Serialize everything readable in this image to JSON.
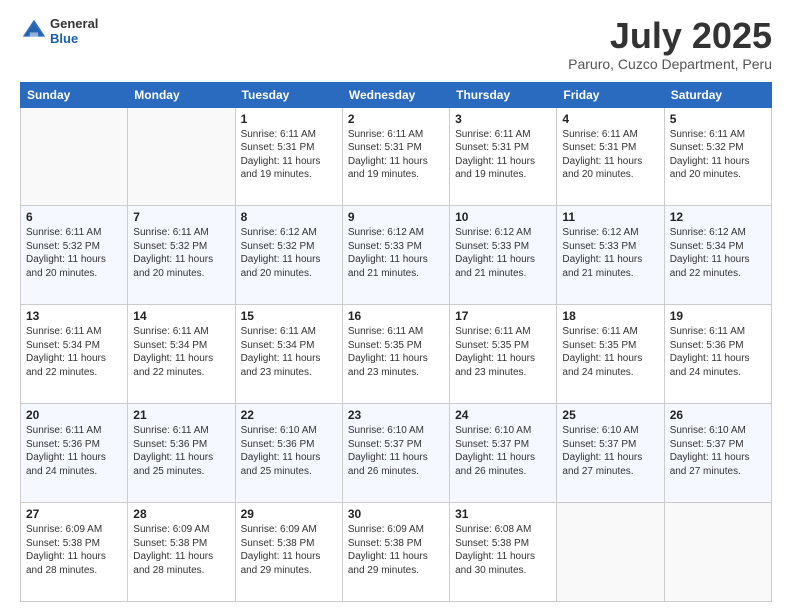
{
  "header": {
    "logo_general": "General",
    "logo_blue": "Blue",
    "title": "July 2025",
    "subtitle": "Paruro, Cuzco Department, Peru"
  },
  "calendar": {
    "days_of_week": [
      "Sunday",
      "Monday",
      "Tuesday",
      "Wednesday",
      "Thursday",
      "Friday",
      "Saturday"
    ],
    "weeks": [
      [
        {
          "day": "",
          "info": ""
        },
        {
          "day": "",
          "info": ""
        },
        {
          "day": "1",
          "info": "Sunrise: 6:11 AM\nSunset: 5:31 PM\nDaylight: 11 hours and 19 minutes."
        },
        {
          "day": "2",
          "info": "Sunrise: 6:11 AM\nSunset: 5:31 PM\nDaylight: 11 hours and 19 minutes."
        },
        {
          "day": "3",
          "info": "Sunrise: 6:11 AM\nSunset: 5:31 PM\nDaylight: 11 hours and 19 minutes."
        },
        {
          "day": "4",
          "info": "Sunrise: 6:11 AM\nSunset: 5:31 PM\nDaylight: 11 hours and 20 minutes."
        },
        {
          "day": "5",
          "info": "Sunrise: 6:11 AM\nSunset: 5:32 PM\nDaylight: 11 hours and 20 minutes."
        }
      ],
      [
        {
          "day": "6",
          "info": "Sunrise: 6:11 AM\nSunset: 5:32 PM\nDaylight: 11 hours and 20 minutes."
        },
        {
          "day": "7",
          "info": "Sunrise: 6:11 AM\nSunset: 5:32 PM\nDaylight: 11 hours and 20 minutes."
        },
        {
          "day": "8",
          "info": "Sunrise: 6:12 AM\nSunset: 5:32 PM\nDaylight: 11 hours and 20 minutes."
        },
        {
          "day": "9",
          "info": "Sunrise: 6:12 AM\nSunset: 5:33 PM\nDaylight: 11 hours and 21 minutes."
        },
        {
          "day": "10",
          "info": "Sunrise: 6:12 AM\nSunset: 5:33 PM\nDaylight: 11 hours and 21 minutes."
        },
        {
          "day": "11",
          "info": "Sunrise: 6:12 AM\nSunset: 5:33 PM\nDaylight: 11 hours and 21 minutes."
        },
        {
          "day": "12",
          "info": "Sunrise: 6:12 AM\nSunset: 5:34 PM\nDaylight: 11 hours and 22 minutes."
        }
      ],
      [
        {
          "day": "13",
          "info": "Sunrise: 6:11 AM\nSunset: 5:34 PM\nDaylight: 11 hours and 22 minutes."
        },
        {
          "day": "14",
          "info": "Sunrise: 6:11 AM\nSunset: 5:34 PM\nDaylight: 11 hours and 22 minutes."
        },
        {
          "day": "15",
          "info": "Sunrise: 6:11 AM\nSunset: 5:34 PM\nDaylight: 11 hours and 23 minutes."
        },
        {
          "day": "16",
          "info": "Sunrise: 6:11 AM\nSunset: 5:35 PM\nDaylight: 11 hours and 23 minutes."
        },
        {
          "day": "17",
          "info": "Sunrise: 6:11 AM\nSunset: 5:35 PM\nDaylight: 11 hours and 23 minutes."
        },
        {
          "day": "18",
          "info": "Sunrise: 6:11 AM\nSunset: 5:35 PM\nDaylight: 11 hours and 24 minutes."
        },
        {
          "day": "19",
          "info": "Sunrise: 6:11 AM\nSunset: 5:36 PM\nDaylight: 11 hours and 24 minutes."
        }
      ],
      [
        {
          "day": "20",
          "info": "Sunrise: 6:11 AM\nSunset: 5:36 PM\nDaylight: 11 hours and 24 minutes."
        },
        {
          "day": "21",
          "info": "Sunrise: 6:11 AM\nSunset: 5:36 PM\nDaylight: 11 hours and 25 minutes."
        },
        {
          "day": "22",
          "info": "Sunrise: 6:10 AM\nSunset: 5:36 PM\nDaylight: 11 hours and 25 minutes."
        },
        {
          "day": "23",
          "info": "Sunrise: 6:10 AM\nSunset: 5:37 PM\nDaylight: 11 hours and 26 minutes."
        },
        {
          "day": "24",
          "info": "Sunrise: 6:10 AM\nSunset: 5:37 PM\nDaylight: 11 hours and 26 minutes."
        },
        {
          "day": "25",
          "info": "Sunrise: 6:10 AM\nSunset: 5:37 PM\nDaylight: 11 hours and 27 minutes."
        },
        {
          "day": "26",
          "info": "Sunrise: 6:10 AM\nSunset: 5:37 PM\nDaylight: 11 hours and 27 minutes."
        }
      ],
      [
        {
          "day": "27",
          "info": "Sunrise: 6:09 AM\nSunset: 5:38 PM\nDaylight: 11 hours and 28 minutes."
        },
        {
          "day": "28",
          "info": "Sunrise: 6:09 AM\nSunset: 5:38 PM\nDaylight: 11 hours and 28 minutes."
        },
        {
          "day": "29",
          "info": "Sunrise: 6:09 AM\nSunset: 5:38 PM\nDaylight: 11 hours and 29 minutes."
        },
        {
          "day": "30",
          "info": "Sunrise: 6:09 AM\nSunset: 5:38 PM\nDaylight: 11 hours and 29 minutes."
        },
        {
          "day": "31",
          "info": "Sunrise: 6:08 AM\nSunset: 5:38 PM\nDaylight: 11 hours and 30 minutes."
        },
        {
          "day": "",
          "info": ""
        },
        {
          "day": "",
          "info": ""
        }
      ]
    ]
  }
}
